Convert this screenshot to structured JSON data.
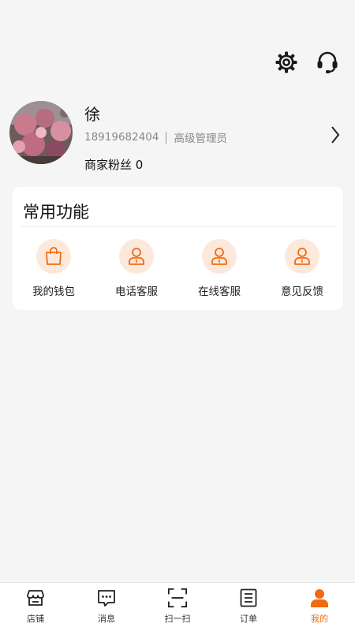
{
  "header": {
    "icons": [
      "gear-icon",
      "headset-icon"
    ]
  },
  "profile": {
    "name": "徐",
    "phone": "18919682404",
    "role": "高级管理员",
    "fans": "商家粉丝 0"
  },
  "common": {
    "title": "常用功能",
    "items": [
      {
        "label": "我的钱包",
        "icon": "wallet-bag-icon"
      },
      {
        "label": "电话客服",
        "icon": "person-icon"
      },
      {
        "label": "在线客服",
        "icon": "person-icon"
      },
      {
        "label": "意见反馈",
        "icon": "person-icon"
      }
    ]
  },
  "tabbar": {
    "items": [
      {
        "label": "店铺",
        "icon": "store-icon"
      },
      {
        "label": "消息",
        "icon": "message-icon"
      },
      {
        "label": "扫一扫",
        "icon": "scan-icon"
      },
      {
        "label": "订单",
        "icon": "order-icon"
      },
      {
        "label": "我的",
        "icon": "profile-icon"
      }
    ],
    "active_index": 4
  },
  "colors": {
    "accent": "#f26a10",
    "icon_bg": "#fde9dc",
    "background": "#f5f5f5"
  }
}
